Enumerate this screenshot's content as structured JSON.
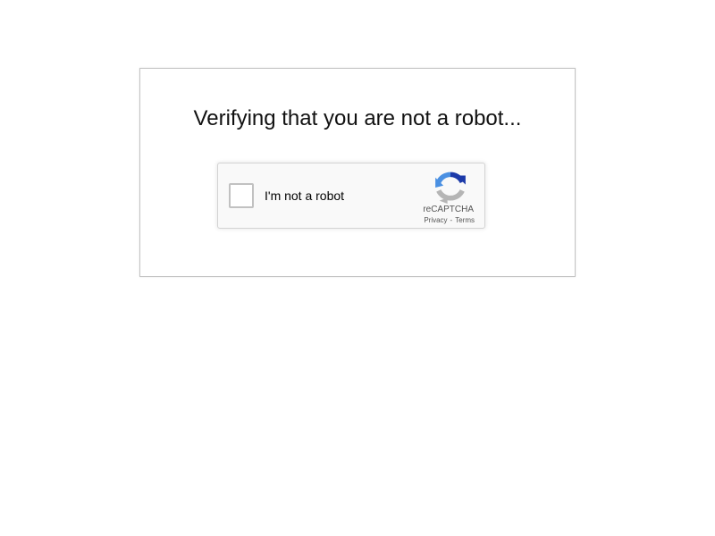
{
  "page": {
    "heading": "Verifying that you are not a robot..."
  },
  "recaptcha": {
    "checkbox_label": "I'm not a robot",
    "brand": "reCAPTCHA",
    "privacy_link": "Privacy",
    "separator": "-",
    "terms_link": "Terms",
    "checked": false,
    "logo_icon": "recaptcha-logo-icon"
  },
  "colors": {
    "logo_blue_dark": "#1c3aa9",
    "logo_blue": "#4a90e2",
    "logo_gray": "#b5b5b5"
  }
}
